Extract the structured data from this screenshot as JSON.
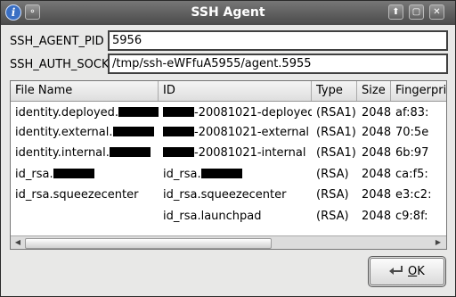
{
  "window": {
    "title": "SSH Agent",
    "controls": {
      "up": "⬆",
      "restore": "▢",
      "close": "✕"
    },
    "info_icon_glyph": "i"
  },
  "fields": {
    "pid_label": "SSH_AGENT_PID",
    "pid_value": "5956",
    "sock_label": "SSH_AUTH_SOCK",
    "sock_value": "/tmp/ssh-eWFfuA5955/agent.5955"
  },
  "table": {
    "columns": [
      "File Name",
      "ID",
      "Type",
      "Size",
      "Fingerprint"
    ],
    "rows": [
      {
        "file": "identity.deployed.",
        "id": "-20081021-deployed",
        "type": "(RSA1)",
        "size": "2048",
        "fingerprint": "af:83:"
      },
      {
        "file": "identity.external.",
        "id": "-20081021-external",
        "type": "(RSA1)",
        "size": "2048",
        "fingerprint": "70:5e"
      },
      {
        "file": "identity.internal.",
        "id": "-20081021-internal",
        "type": "(RSA1)",
        "size": "2048",
        "fingerprint": "6b:97"
      },
      {
        "file": "id_rsa.",
        "id": "id_rsa.",
        "type": "(RSA)",
        "size": "2048",
        "fingerprint": "ca:f5:"
      },
      {
        "file": "id_rsa.squeezecenter",
        "id": "id_rsa.squeezecenter",
        "type": "(RSA)",
        "size": "2048",
        "fingerprint": "e3:c2:"
      },
      {
        "file": "",
        "id": "id_rsa.launchpad",
        "type": "(RSA)",
        "size": "2048",
        "fingerprint": "c9:8f:"
      }
    ],
    "scroll_arrows": {
      "left": "◀",
      "right": "▶"
    }
  },
  "ok_button": {
    "label": "OK",
    "icon": "return-arrow-icon"
  }
}
